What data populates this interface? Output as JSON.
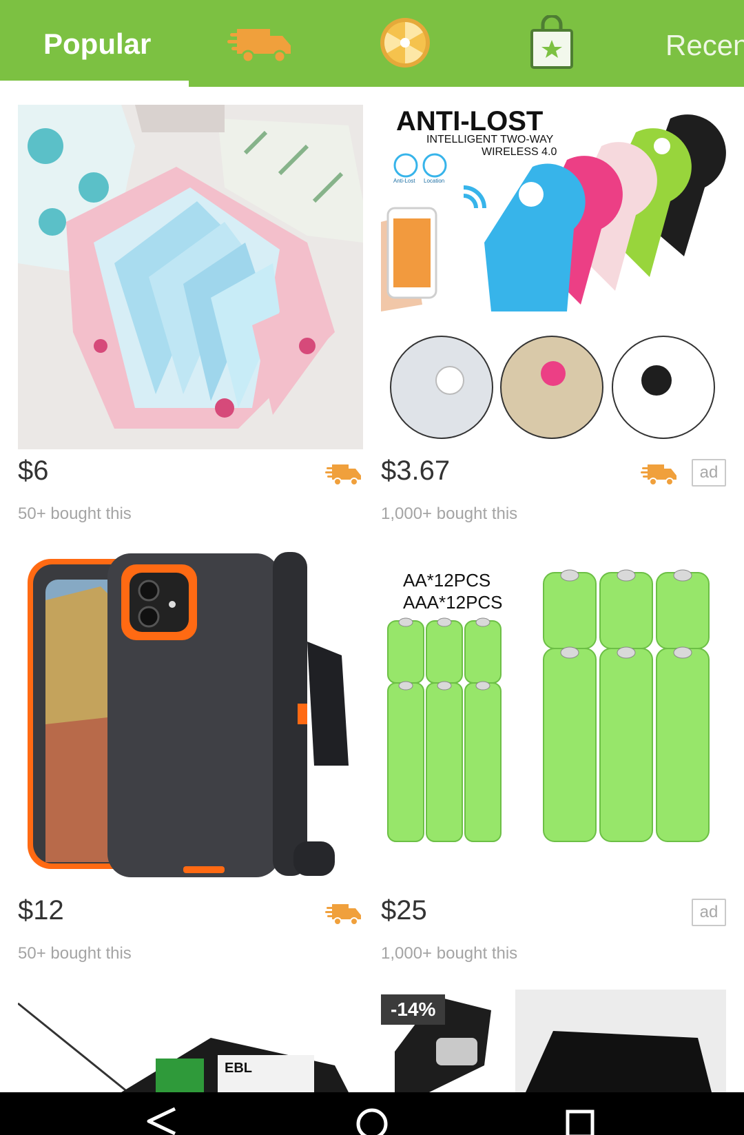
{
  "tabs": {
    "popular_label": "Popular",
    "icons": [
      "fast-shipping-icon",
      "wheel-icon",
      "shopping-bag-icon"
    ],
    "recent_label": "Recen"
  },
  "products": [
    {
      "price": "$6",
      "bought": "50+ bought this",
      "fast_shipping": true,
      "ad": false
    },
    {
      "price": "$3.67",
      "bought": "1,000+ bought this",
      "fast_shipping": true,
      "ad": true,
      "ad_label": "ad",
      "image_text": {
        "title": "ANTI-LOST",
        "sub1": "INTELLIGENT TWO-WAY",
        "sub2": "WIRELESS 4.0",
        "caption1": "Anti-Lost",
        "caption2": "Location"
      }
    },
    {
      "price": "$12",
      "bought": "50+ bought this",
      "fast_shipping": true,
      "ad": false
    },
    {
      "price": "$25",
      "bought": "1,000+ bought this",
      "fast_shipping": false,
      "ad": true,
      "ad_label": "ad",
      "image_text": {
        "line1": "AA*12PCS",
        "line2": "AAA*12PCS"
      }
    },
    {
      "partial": true
    },
    {
      "partial": true,
      "discount": "-14%"
    }
  ],
  "colors": {
    "brand_green": "#7cc142",
    "shipping_orange": "#f0a03c"
  }
}
